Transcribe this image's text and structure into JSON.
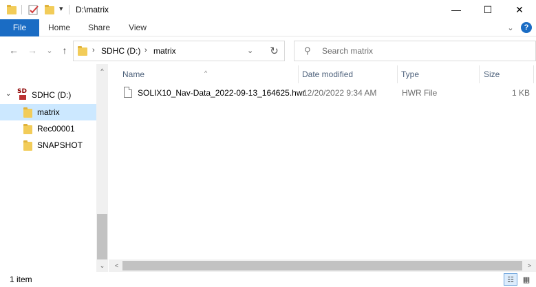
{
  "window": {
    "title": "D:\\matrix",
    "minimize_glyph": "—",
    "maximize_glyph": "☐",
    "close_glyph": "✕",
    "dropdown_glyph": "▾"
  },
  "ribbon": {
    "tabs": [
      {
        "label": "File"
      },
      {
        "label": "Home"
      },
      {
        "label": "Share"
      },
      {
        "label": "View"
      }
    ],
    "expand_glyph": "⌄",
    "help_glyph": "?"
  },
  "nav": {
    "back_glyph": "←",
    "forward_glyph": "→",
    "recent_glyph": "⌄",
    "up_glyph": "↑",
    "breadcrumb": [
      "SDHC (D:)",
      "matrix"
    ],
    "crumb_sep_glyph": "›",
    "address_dropdown_glyph": "⌄",
    "refresh_glyph": "↻",
    "search_glyph": "⚲",
    "search_placeholder": "Search matrix"
  },
  "tree": {
    "drive": {
      "label": "SDHC (D:)",
      "icon_text": "SD",
      "chevron": "⌄"
    },
    "folders": [
      {
        "label": "matrix",
        "selected": true
      },
      {
        "label": "Rec00001",
        "selected": false
      },
      {
        "label": "SNAPSHOT",
        "selected": false
      }
    ]
  },
  "columns": {
    "name": "Name",
    "date_modified": "Date modified",
    "type": "Type",
    "size": "Size",
    "sort_glyph": "^"
  },
  "files": [
    {
      "name": "SOLIX10_Nav-Data_2022-09-13_164625.hwr",
      "date_modified": "12/20/2022 9:34 AM",
      "type": "HWR File",
      "size": "1 KB"
    }
  ],
  "scroll": {
    "up_glyph": "^",
    "down_glyph": "⌄",
    "left_glyph": "<",
    "right_glyph": ">"
  },
  "status": {
    "item_count": "1 item",
    "details_view_glyph": "☷",
    "large_icons_glyph": "▦"
  },
  "colors": {
    "accent": "#1a6cc4",
    "selection": "#cce8ff",
    "folder": "#f2cc59",
    "header_text": "#4c607a"
  }
}
